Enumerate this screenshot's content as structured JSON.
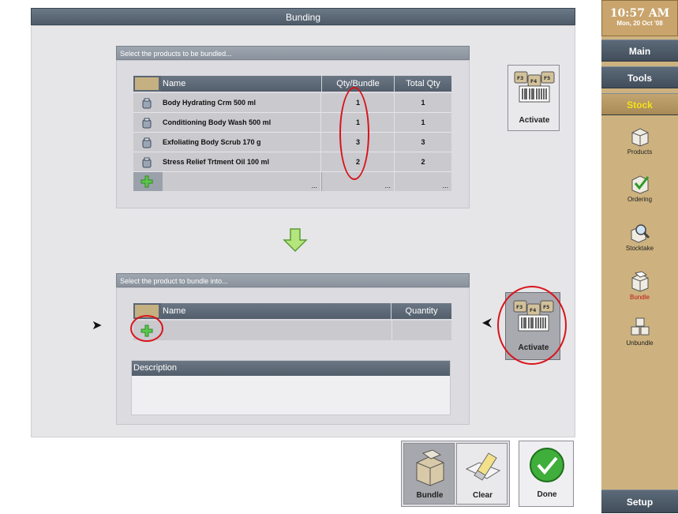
{
  "window": {
    "title": "Bunding"
  },
  "source_section": {
    "header": "Select the products to be bundled...",
    "columns": [
      "Name",
      "Qty/Bundle",
      "Total Qty"
    ],
    "rows": [
      {
        "name": "Body Hydrating Crm 500 ml",
        "qty_bundle": "1",
        "total_qty": "1"
      },
      {
        "name": "Conditioning Body Wash 500 ml",
        "qty_bundle": "1",
        "total_qty": "1"
      },
      {
        "name": "Exfoliating Body Scrub 170 g",
        "qty_bundle": "3",
        "total_qty": "3"
      },
      {
        "name": "Stress Relief Trtment Oil 100 ml",
        "qty_bundle": "2",
        "total_qty": "2"
      }
    ],
    "ellipsis": "...",
    "activate_label": "Activate",
    "key_labels": [
      "F3",
      "F4",
      "F5"
    ]
  },
  "target_section": {
    "header": "Select the product to bundle into...",
    "columns": [
      "Name",
      "Quantity"
    ],
    "description_label": "Description",
    "activate_label": "Activate",
    "key_labels": [
      "F3",
      "F4",
      "F5"
    ]
  },
  "actions": {
    "bundle": "Bundle",
    "clear": "Clear",
    "done": "Done"
  },
  "sidebar": {
    "time": "10:57 AM",
    "date": "Mon, 20 Oct '08",
    "main": "Main",
    "tools": "Tools",
    "stock": "Stock",
    "items": [
      "Products",
      "Ordering",
      "Stocktake",
      "Bundle",
      "Unbundle"
    ],
    "setup": "Setup"
  },
  "colors": {
    "accent_red": "#d8141a",
    "stock_yellow": "#f4e11a",
    "sidebar_tan": "#cdb27f"
  }
}
